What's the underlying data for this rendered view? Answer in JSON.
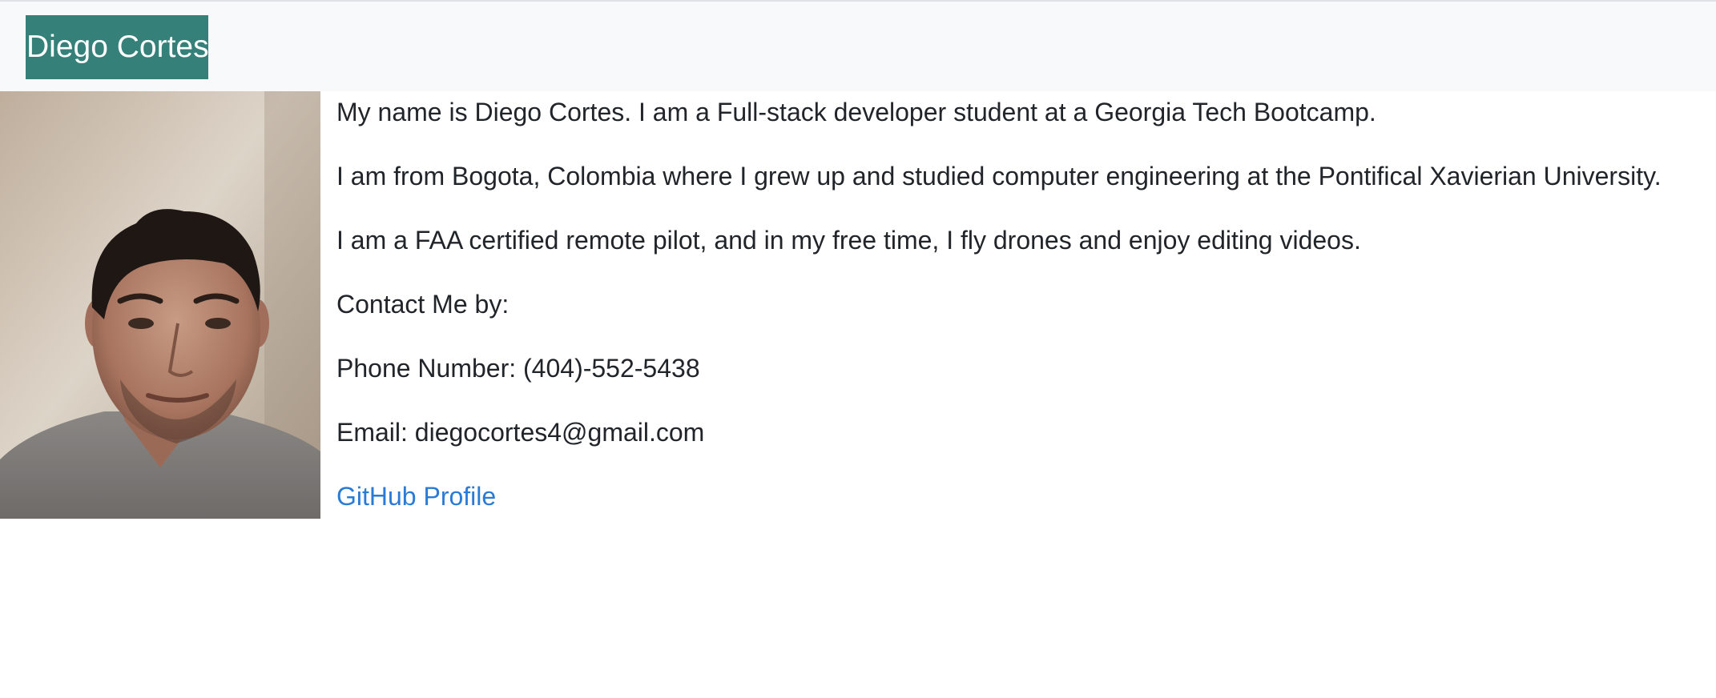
{
  "navbar": {
    "brand": "Diego Cortes"
  },
  "profile": {
    "photo_alt": "Portrait photo of Diego Cortes"
  },
  "about": {
    "intro": "My name is Diego Cortes. I am a Full-stack developer student at a Georgia Tech Bootcamp.",
    "origin": "I am from Bogota, Colombia where I grew up and studied computer engineering at the Pontifical Xavierian University.",
    "hobbies": "I am a FAA certified remote pilot, and in my free time, I fly drones and enjoy editing videos.",
    "contact_heading": "Contact Me by:",
    "phone": "Phone Number: (404)-552-5438",
    "email": "Email: diegocortes4@gmail.com",
    "github_label": "GitHub Profile"
  },
  "colors": {
    "navbar_bg": "#f8f9fa",
    "brand_bg": "#35817a",
    "link": "#2a7bd6",
    "text": "#212529"
  }
}
